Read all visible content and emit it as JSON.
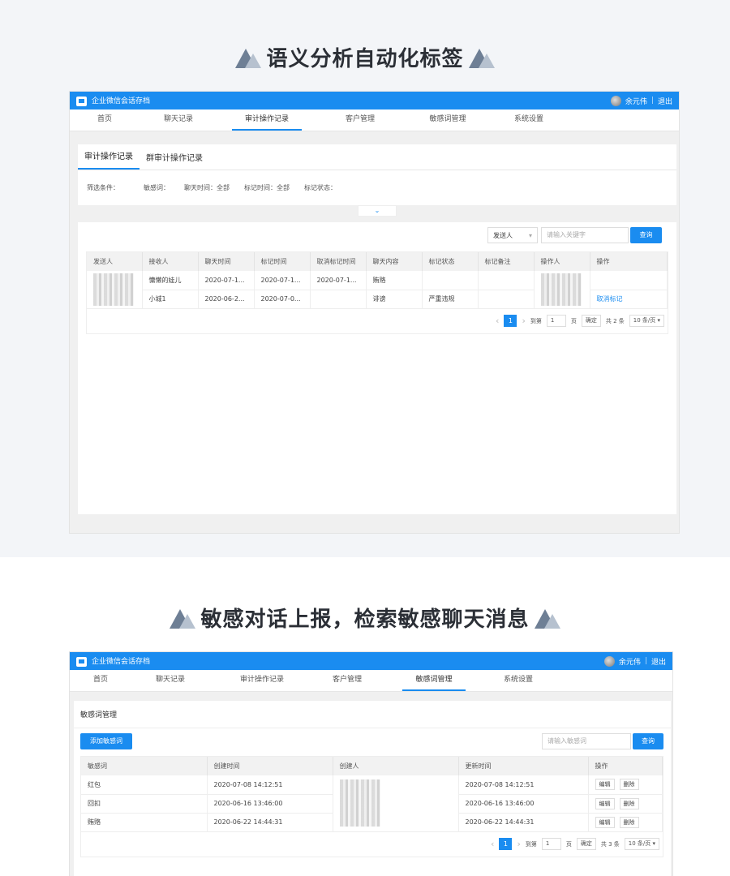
{
  "section1": {
    "heading": "语义分析自动化标签"
  },
  "section2": {
    "heading": "敏感对话上报，检索敏感聊天消息"
  },
  "app": {
    "title": "企业微信会话存档",
    "user": "余元伟",
    "separator": "|",
    "logout": "退出",
    "nav": [
      "首页",
      "聊天记录",
      "审计操作记录",
      "客户管理",
      "敏感词管理",
      "系统设置"
    ]
  },
  "s1": {
    "tabs": [
      "审计操作记录",
      "群审计操作记录"
    ],
    "filters": [
      "筛选条件：",
      "敏感词：",
      "聊天时间：全部",
      "标记时间：全部",
      "标记状态："
    ],
    "toggle_icon": "⌄",
    "search_select": "发送人",
    "search_placeholder": "请输入关键字",
    "search_button": "查询",
    "columns": [
      "发送人",
      "接收人",
      "聊天时间",
      "标记时间",
      "取消标记时间",
      "聊天内容",
      "标记状态",
      "标记备注",
      "操作人",
      "操作"
    ],
    "rows": [
      [
        "",
        "慵懒的娃儿",
        "2020-07-1...",
        "2020-07-1...",
        "2020-07-1...",
        "贿赂",
        "",
        "",
        "",
        ""
      ],
      [
        "",
        "小城1",
        "2020-06-2...",
        "2020-07-0...",
        "",
        "诽谤",
        "严重违规",
        "",
        "",
        "取消标记"
      ]
    ],
    "pager": {
      "prev": "‹",
      "page": "1",
      "next": "›",
      "goto": "到第",
      "goto_val": "1",
      "page_unit": "页",
      "confirm": "确定",
      "total": "共 2 条",
      "size": "10 条/页 ▾"
    }
  },
  "s2": {
    "card_title": "敏感词管理",
    "add_button": "添加敏感词",
    "search_placeholder": "请输入敏感词",
    "search_button": "查询",
    "columns": [
      "敏感词",
      "创建时间",
      "创建人",
      "更新时间",
      "操作"
    ],
    "rows": [
      [
        "红包",
        "2020-07-08 14:12:51",
        "",
        "2020-07-08 14:12:51"
      ],
      [
        "回扣",
        "2020-06-16 13:46:00",
        "",
        "2020-06-16 13:46:00"
      ],
      [
        "贿赂",
        "2020-06-22 14:44:31",
        "",
        "2020-06-22 14:44:31"
      ]
    ],
    "edit": "编辑",
    "delete": "删除",
    "pager": {
      "prev": "‹",
      "page": "1",
      "next": "›",
      "goto": "到第",
      "goto_val": "1",
      "page_unit": "页",
      "confirm": "确定",
      "total": "共 3 条",
      "size": "10 条/页 ▾"
    }
  },
  "colors": {
    "accent": "#1a8cf0",
    "page_bg": "#f3f5f8"
  }
}
